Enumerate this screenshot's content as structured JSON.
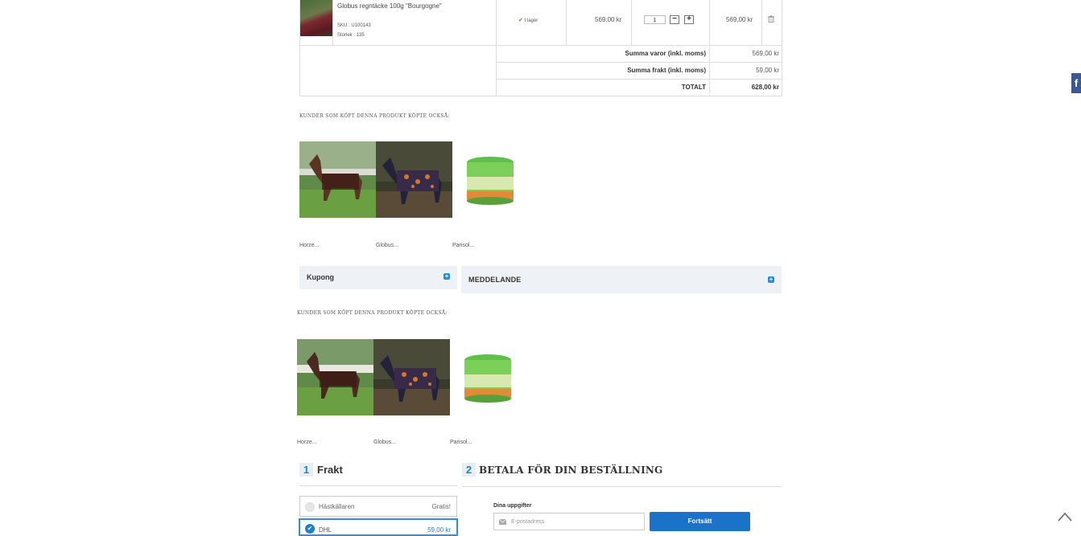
{
  "cart": {
    "item": {
      "name": "Globus regntäcke 100g \"Bourgogne\"",
      "sku": "SKU : U100143",
      "size": "Storlek : 135",
      "stock": "I lager",
      "unit_price": "569,00 kr",
      "quantity": "1",
      "minus": "−",
      "plus": "+",
      "total": "569,00 kr"
    },
    "summary": [
      {
        "label": "Summa varor (inkl. moms)",
        "value": "569,00 kr"
      },
      {
        "label": "Summa frakt (inkl. moms)",
        "value": "59,00 kr"
      },
      {
        "label": "TOTALT",
        "value": "628,00 kr"
      }
    ]
  },
  "recommendations_1": {
    "heading": "KUNDER SOM KÖPT DENNA PRODUKT KÖPTE OCKSÅ:",
    "items": [
      {
        "name": "Horze..."
      },
      {
        "name": "Globus..."
      },
      {
        "name": "Parisol..."
      }
    ]
  },
  "coupon": {
    "label": "Kupong",
    "toggle": "+"
  },
  "message": {
    "label": "MEDDELANDE",
    "toggle": "+"
  },
  "recommendations_2": {
    "heading": "KUNDER SOM KÖPT DENNA PRODUKT KÖPTE OCKSÅ:",
    "items": [
      {
        "name": "Horze..."
      },
      {
        "name": "Globus..."
      },
      {
        "name": "Parisol..."
      }
    ]
  },
  "shipping": {
    "step": "1",
    "title": "Frakt",
    "options": [
      {
        "name": "Hästkällaren",
        "price": "Gratis!",
        "selected": false
      },
      {
        "name": "DHL",
        "price": "59,00 kr",
        "selected": true
      }
    ]
  },
  "payment": {
    "step": "2",
    "title": "BETALA FÖR DIN BESTÄLLNING",
    "details_label": "Dina uppgifter",
    "email_placeholder": "E-postadress",
    "continue_label": "Fortsätt"
  },
  "social": {
    "facebook_label": "f"
  },
  "colors": {
    "accent": "#1a73c8",
    "facebook": "#3b5998",
    "panel": "#eef1f5"
  }
}
